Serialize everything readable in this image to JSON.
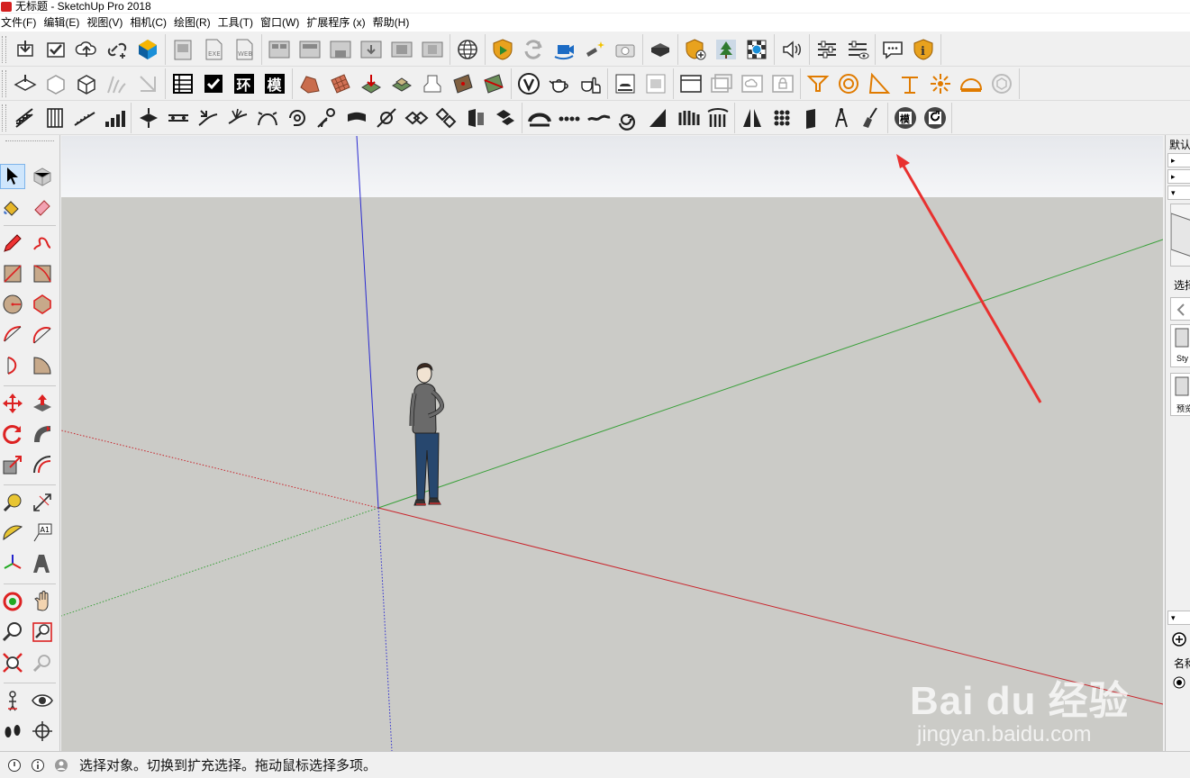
{
  "app": {
    "title": "无标题 - SketchUp Pro 2018",
    "brand_color": "#d41f1f"
  },
  "menu": {
    "items": [
      {
        "label": "文件(F)"
      },
      {
        "label": "编辑(E)"
      },
      {
        "label": "视图(V)"
      },
      {
        "label": "相机(C)"
      },
      {
        "label": "绘图(R)"
      },
      {
        "label": "工具(T)"
      },
      {
        "label": "窗口(W)"
      },
      {
        "label": "扩展程序 (x)"
      },
      {
        "label": "帮助(H)"
      }
    ]
  },
  "toolbar2": {
    "ext_labels": [
      "环",
      "模"
    ]
  },
  "toolbar3": {
    "badge_label": "模"
  },
  "tray": {
    "title": "默认",
    "panel_rows": [
      "▸",
      "▸",
      "▾"
    ],
    "section_select": "选择",
    "items": [
      "Sty",
      "预览"
    ],
    "bottom_section": "▾",
    "name_label": "名称"
  },
  "status": {
    "text": "选择对象。切换到扩充选择。拖动鼠标选择多项。"
  },
  "watermark": {
    "main": "Bai du 经验",
    "sub": "jingyan.baidu.com"
  },
  "colors": {
    "sky": "#f2f3f5",
    "ground": "#cbcbc7",
    "axis_red": "#c9242b",
    "axis_green": "#3aa03a",
    "axis_blue": "#2a2ad0",
    "arrow": "#e8312f"
  }
}
